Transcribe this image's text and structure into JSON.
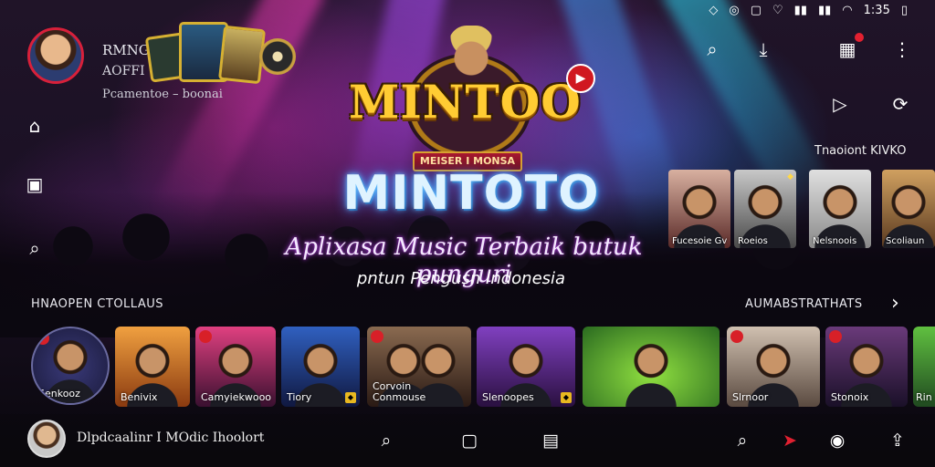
{
  "status_bar": {
    "time": "1:35"
  },
  "profile": {
    "name": "RMNG",
    "subtitle": "AOFFI",
    "line": "Pcamentoe – boonai"
  },
  "logo": {
    "title": "MINTOO",
    "ribbon": "MEISER I MONSA"
  },
  "hero": {
    "title": "MINTOTO",
    "tagline_1": "Aplixasa Music Terbaik butuk punguri",
    "tagline_2": "pntun Pengusn Indonesia"
  },
  "right_panel": {
    "label": "Tnaoiont KIVKO",
    "tiles": [
      {
        "caption": "Fucesoie Gv"
      },
      {
        "caption": "Roeios"
      },
      {
        "caption": "Nelsnoois"
      },
      {
        "caption": "Scoliaun"
      }
    ]
  },
  "section": {
    "left_title": "HNAOPEN CTOLLAUS",
    "right_title": "AUMABSTRATHATS",
    "tiles": [
      {
        "caption": "Senkooz"
      },
      {
        "caption": "Benivix"
      },
      {
        "caption": "Camyiekwooo"
      },
      {
        "caption": "Tiory"
      },
      {
        "caption": "Corvoin Conmouse"
      },
      {
        "caption": "Slenoopes"
      },
      {
        "caption": ""
      },
      {
        "caption": "Slrnoor"
      },
      {
        "caption": "Stonoix"
      },
      {
        "caption": "Rin"
      }
    ]
  },
  "bottom_bar": {
    "now_playing": "Dlpdcaalinr I MOdic  Ihoolort"
  },
  "icons": {
    "search": "search-icon",
    "download": "download-icon",
    "inbox": "inbox-icon",
    "more": "more-vertical-icon",
    "home": "home-icon",
    "library": "library-icon",
    "camera": "camera-icon",
    "share": "share-icon"
  },
  "colors": {
    "accent_red": "#d82028",
    "gold": "#ffcc33",
    "neon_blue": "#6ec8ff",
    "neon_purple": "#c040ff"
  }
}
